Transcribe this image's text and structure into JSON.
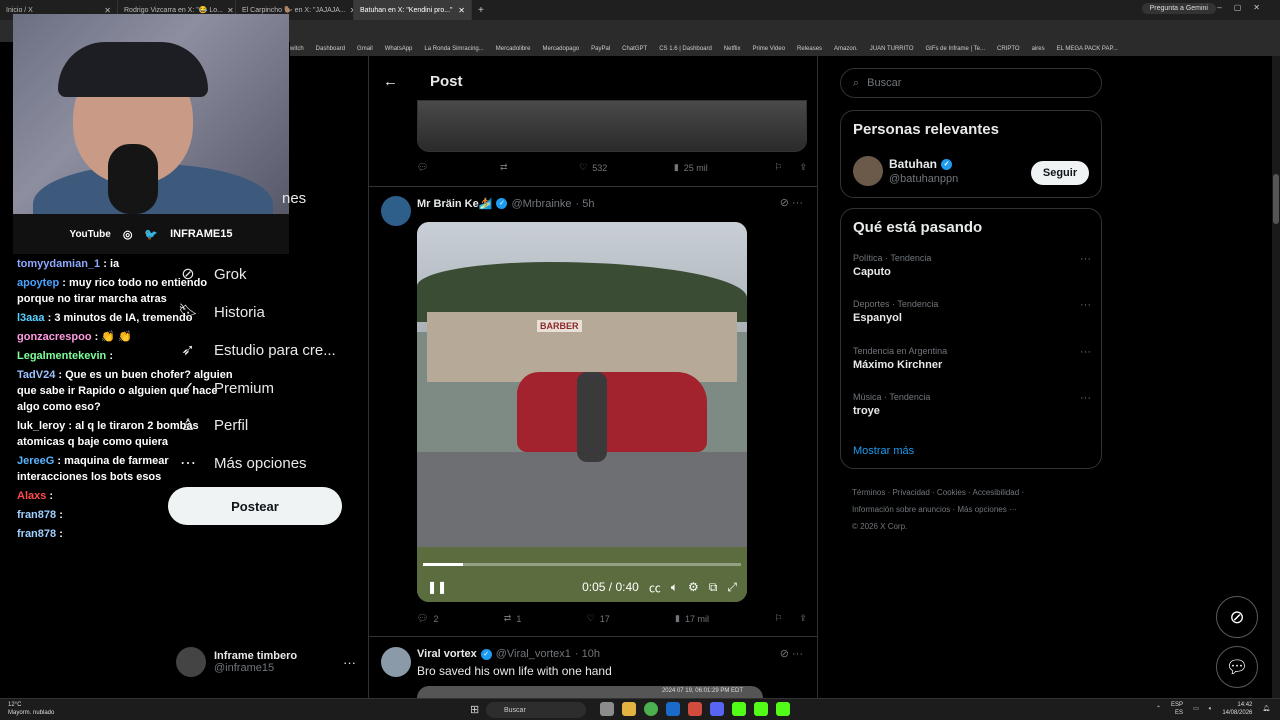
{
  "browser": {
    "tabs": [
      {
        "label": "Inicio / X"
      },
      {
        "label": "Rodrigo Vizcarra en X: \"😂 Lo..."
      },
      {
        "label": "El Carpincho 🦫 en X: \"JAJAJA..."
      },
      {
        "label": "Batuhan en X: \"Kendini pro...\"",
        "active": true
      }
    ],
    "gemini_label": "Pregunta a Gemini",
    "bookmarks": [
      "witch",
      "Dashboard",
      "Gmail",
      "WhatsApp",
      "La Ronda Simracing...",
      "Mercadolibre",
      "Mercadopago",
      "PayPal",
      "ChatGPT",
      "CS 1.6 | Dashboard",
      "Netflix",
      "Prime Video",
      "Releases",
      "Amazon.",
      "JUAN TURRITO",
      "GIFs de Inframe | Te...",
      "CRIPTO",
      "aires",
      "EL MEGA PACK PAP..."
    ]
  },
  "stream_overlay": {
    "social_labels": [
      "YouTube",
      "INFRAME15"
    ],
    "chat": [
      {
        "user": "tomyydamian_1",
        "text": ": ia",
        "color": "#8fa8ff"
      },
      {
        "user": "apoytep",
        "text": ": muy rico todo no entiendo porque no tirar marcha atras",
        "color": "#4aa3ff"
      },
      {
        "user": "l3aaa",
        "text": ": 3 minutos de IA, tremendo",
        "color": "#5ad1ff"
      },
      {
        "user": "gonzacrespoo",
        "text": ": 👏 👏",
        "color": "#ff9ae0"
      },
      {
        "user": "Legalmentekevin",
        "text": ":",
        "color": "#7dff9a"
      },
      {
        "user": "TadV24",
        "text": ": Que es un buen chofer? alguien que sabe ir Rapido o alguien que hace algo como eso?",
        "color": "#9ec2ff"
      },
      {
        "user": "luk_leroy",
        "text": ": al q le tiraron 2 bombas atomicas q baje como quiera",
        "color": "#ffffff"
      },
      {
        "user": "JereeG",
        "text": ": maquina de farmear interacciones los bots esos",
        "color": "#5ab4ff"
      },
      {
        "user": "Alaxs",
        "text": ":",
        "color": "#ff4b4b"
      },
      {
        "user": "fran878",
        "text": ":",
        "color": "#9dd0ff"
      },
      {
        "user": "fran878",
        "text": ":",
        "color": "#9dd0ff"
      }
    ]
  },
  "left_nav": {
    "partial_item": "nes",
    "items": [
      {
        "label": "Grok",
        "icon": "grok-icon"
      },
      {
        "label": "Historia",
        "icon": "bookmark-icon"
      },
      {
        "label": "Estudio para cre...",
        "icon": "rocket-icon"
      },
      {
        "label": "Premium",
        "icon": "verified-icon"
      },
      {
        "label": "Perfil",
        "icon": "person-icon"
      },
      {
        "label": "Más opciones",
        "icon": "more-circle-icon"
      }
    ],
    "post_button": "Postear",
    "account": {
      "name": "Inframe timbero",
      "handle": "@inframe15"
    }
  },
  "main": {
    "header_title": "Post",
    "first_actions": {
      "replies": "",
      "retweets": "",
      "likes": "532",
      "views": "25 mil"
    },
    "tweet1": {
      "name": "Mr Bräin Ke🏄",
      "handle": "@Mrbrainke",
      "time": "· 5h",
      "video": {
        "time": "0:05 / 0:40",
        "progress": 0.125,
        "sign_text": "BARBER"
      },
      "actions": {
        "replies": "2",
        "retweets": "1",
        "likes": "17",
        "views": "17 mil"
      }
    },
    "tweet2": {
      "name": "Viral vortex",
      "handle": "@Viral_vortex1",
      "time": "· 10h",
      "text": "Bro saved his own life with one hand",
      "media_stamp": "2024 07 19, 06:01:29 PM EDT"
    }
  },
  "right": {
    "search_placeholder": "Buscar",
    "relevant_title": "Personas relevantes",
    "person": {
      "name": "Batuhan",
      "handle": "@batuhanppn",
      "follow": "Seguir"
    },
    "trending_title": "Qué está pasando",
    "trends": [
      {
        "category": "Política · Tendencia",
        "name": "Caputo"
      },
      {
        "category": "Deportes · Tendencia",
        "name": "Espanyol"
      },
      {
        "category": "Tendencia en Argentina",
        "name": "Máximo Kirchner"
      },
      {
        "category": "Música · Tendencia",
        "name": "troye"
      }
    ],
    "show_more": "Mostrar más",
    "footer": [
      "Términos",
      "Privacidad",
      "Cookies",
      "Accesibilidad",
      "Información sobre anuncios",
      "Más opciones ···",
      "© 2026 X Corp."
    ]
  },
  "taskbar": {
    "weather_temp": "12°C",
    "weather_desc": "Mayorm. nublado",
    "search": "Buscar",
    "lang": "ESP",
    "region": "ES",
    "time": "14:42",
    "date": "14/08/2026"
  },
  "colors": {
    "accent": "#1d9bf0",
    "background": "#000000",
    "border": "#2f3336",
    "muted": "#71767b"
  }
}
